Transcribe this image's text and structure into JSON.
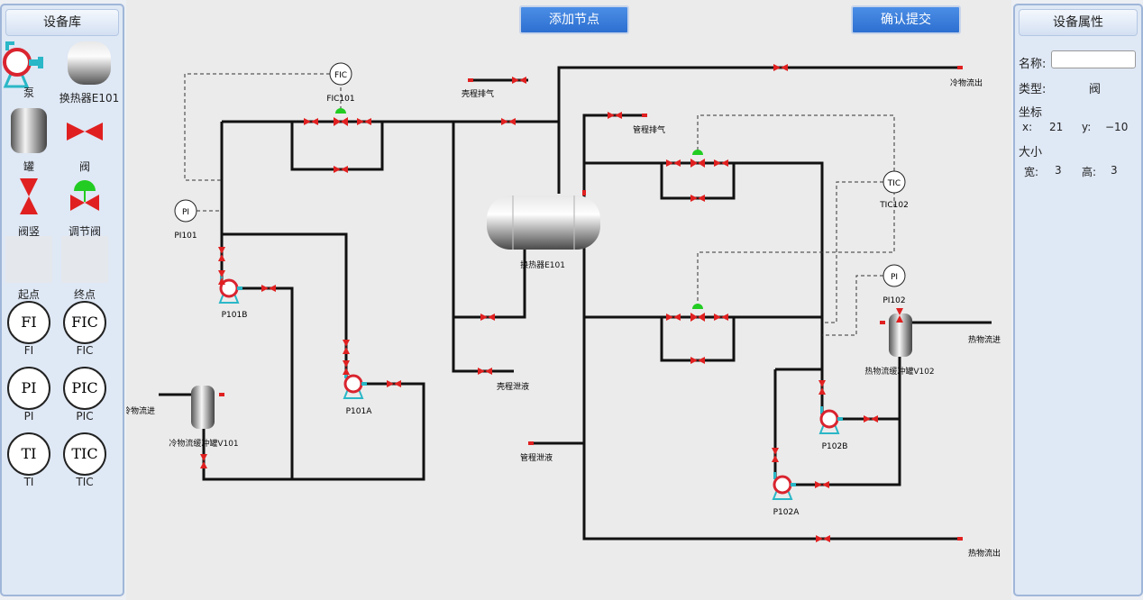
{
  "left_panel": {
    "title": "设备库",
    "items": [
      {
        "label": "泵",
        "icon": "pump-icon"
      },
      {
        "label": "换热器E101",
        "icon": "heat-exchanger-icon"
      },
      {
        "label": "罐",
        "icon": "tank-icon"
      },
      {
        "label": "阀",
        "icon": "valve-icon"
      },
      {
        "label": "阀竖",
        "icon": "vertical-valve-icon"
      },
      {
        "label": "调节阀",
        "icon": "control-valve-icon"
      },
      {
        "label": "起点",
        "icon": "start-point-icon"
      },
      {
        "label": "终点",
        "icon": "end-point-icon"
      }
    ],
    "instruments": [
      {
        "symbol": "FI",
        "label": "FI"
      },
      {
        "symbol": "FIC",
        "label": "FIC"
      },
      {
        "symbol": "PI",
        "label": "PI"
      },
      {
        "symbol": "PIC",
        "label": "PIC"
      },
      {
        "symbol": "TI",
        "label": "TI"
      },
      {
        "symbol": "TIC",
        "label": "TIC"
      }
    ]
  },
  "toolbar": {
    "add_node": "添加节点",
    "confirm_submit": "确认提交"
  },
  "right_panel": {
    "title": "设备属性",
    "name_label": "名称:",
    "name_value": "",
    "type_label": "类型:",
    "type_value": "阀",
    "coord_label": "坐标",
    "x_label": "x:",
    "x_value": "21",
    "y_label": "y:",
    "y_value": "−10",
    "size_label": "大小",
    "w_label": "宽:",
    "w_value": "3",
    "h_label": "高:",
    "h_value": "3"
  },
  "diagram": {
    "instruments": {
      "fic101": "FIC",
      "fic101_tag": "FIC101",
      "pi101": "PI",
      "pi101_tag": "PI101",
      "tic102": "TIC",
      "tic102_tag": "TIC102",
      "pi102": "PI",
      "pi102_tag": "PI102"
    },
    "equipment": {
      "e101": "换热器E101",
      "v101": "冷物流缓冲罐V101",
      "v102": "热物流缓冲罐V102",
      "p101a": "P101A",
      "p101b": "P101B",
      "p102a": "P102A",
      "p102b": "P102B"
    },
    "streams": {
      "cold_in": "冷物流进",
      "cold_out": "冷物流出",
      "hot_in": "热物流进",
      "hot_out": "热物流出",
      "shell_vent": "壳程排气",
      "tube_vent": "管程排气",
      "shell_drain": "壳程泄液",
      "tube_drain": "管程泄液"
    }
  },
  "colors": {
    "pipe": "#111111",
    "valve": "#e02020",
    "control_valve_top": "#22cc22",
    "pump": "#d9242f",
    "pump_base": "#2ab7c7",
    "button": "#3a7fdc"
  }
}
